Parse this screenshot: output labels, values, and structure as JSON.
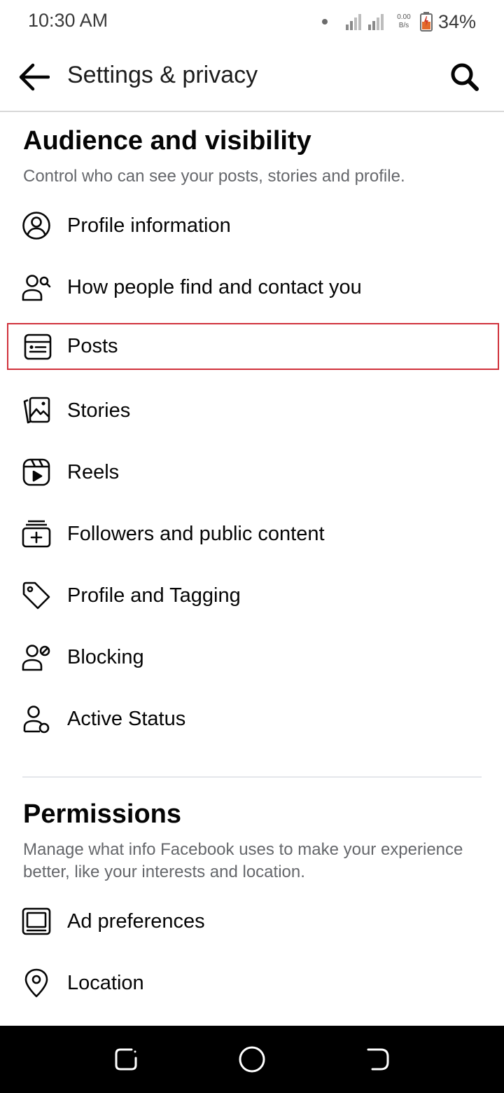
{
  "status_bar": {
    "time": "10:30 AM",
    "net_speed_value": "0.00",
    "net_speed_unit": "B/s",
    "battery": "34%"
  },
  "header": {
    "title": "Settings & privacy",
    "back_icon": "arrow-left-icon",
    "search_icon": "search-icon"
  },
  "audience": {
    "title": "Audience and visibility",
    "description": "Control who can see your posts, stories and profile.",
    "items": [
      {
        "label": "Profile information",
        "icon": "profile-circle-icon"
      },
      {
        "label": "How people find and contact you",
        "icon": "person-search-icon"
      },
      {
        "label": "Posts",
        "icon": "post-card-icon",
        "highlighted": true
      },
      {
        "label": "Stories",
        "icon": "stories-icon"
      },
      {
        "label": "Reels",
        "icon": "reels-icon"
      },
      {
        "label": "Followers and public content",
        "icon": "followers-add-icon"
      },
      {
        "label": "Profile and Tagging",
        "icon": "tag-icon"
      },
      {
        "label": "Blocking",
        "icon": "person-block-icon"
      },
      {
        "label": "Active Status",
        "icon": "person-active-icon"
      }
    ]
  },
  "permissions": {
    "title": "Permissions",
    "description": "Manage what info Facebook uses to make your experience better, like your interests and location.",
    "items": [
      {
        "label": "Ad preferences",
        "icon": "monitor-icon"
      },
      {
        "label": "Location",
        "icon": "location-pin-icon"
      }
    ]
  },
  "colors": {
    "highlight_border": "#d0313b",
    "secondary_text": "#65676b",
    "primary_text": "#050505"
  }
}
